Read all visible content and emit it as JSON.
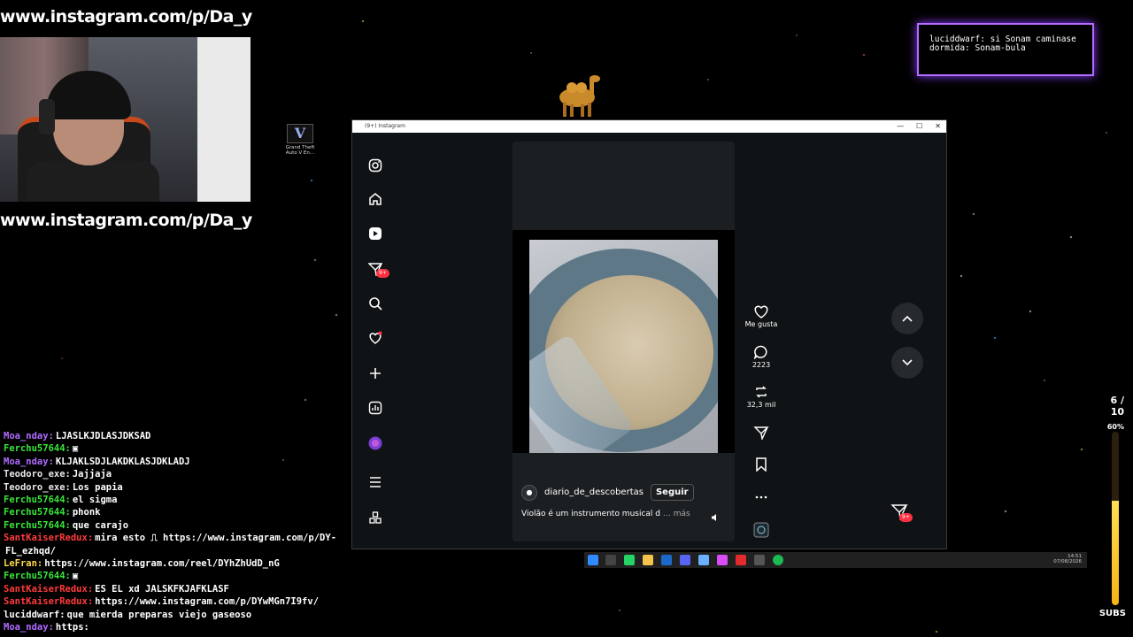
{
  "stream": {
    "url_banner": "www.instagram.com/p/Da_yt",
    "overlay_chat": "luciddwarf: si Sonam caminase dormida: Sonam-bula",
    "sub_goal": {
      "count": "6 / 10",
      "percent": "60%",
      "fraction": 0.6,
      "label": "SUBS"
    }
  },
  "desktop": {
    "icon_label": "Grand Theft Auto V En..."
  },
  "window": {
    "title": "(9+) Instagram",
    "controls": [
      "—",
      "☐",
      "✕"
    ]
  },
  "sidebar": {
    "items": [
      {
        "name": "instagram-logo-icon"
      },
      {
        "name": "home-icon"
      },
      {
        "name": "reels-icon"
      },
      {
        "name": "messages-icon",
        "badge": "9+"
      },
      {
        "name": "search-icon"
      },
      {
        "name": "notifications-icon"
      },
      {
        "name": "create-icon"
      },
      {
        "name": "dashboard-icon"
      },
      {
        "name": "profile-avatar"
      },
      {
        "name": "menu-icon"
      },
      {
        "name": "apps-icon"
      }
    ]
  },
  "reel": {
    "author": "diario_de_descobertas",
    "follow_label": "Seguir",
    "caption": "Violão é um instrumento musical d",
    "caption_more": "… más",
    "actions": {
      "like_label": "Me gusta",
      "comments": "2223",
      "reposts": "32,3 mil"
    }
  },
  "messages_badge": "9+",
  "taskbar": {
    "time": "14:51",
    "date": "07/08/2026"
  },
  "chat": [
    {
      "user": "Moa_nday:",
      "msg": "LJASLKJDLASJDKSAD",
      "color": "#b06cff"
    },
    {
      "user": "Ferchu57644:",
      "msg": "▣",
      "color": "#39e639"
    },
    {
      "user": "Moa_nday:",
      "msg": "KLJAKLSDJLAKDKLASJDKLADJ",
      "color": "#b06cff"
    },
    {
      "user": "Teodoro_exe:",
      "msg": "Jajjaja",
      "color": "#e8e8e8"
    },
    {
      "user": "Teodoro_exe:",
      "msg": "Los papia",
      "color": "#e8e8e8"
    },
    {
      "user": "Ferchu57644:",
      "msg": "el sigma",
      "color": "#39e639"
    },
    {
      "user": "Ferchu57644:",
      "msg": "phonk",
      "color": "#39e639"
    },
    {
      "user": "Ferchu57644:",
      "msg": "que carajo",
      "color": "#39e639"
    },
    {
      "user": "SantKaiserRedux:",
      "msg": "mira esto ⎍ https://www.instagram.com/p/DY-",
      "color": "#ff3b3b"
    },
    {
      "user": "",
      "msg": "FL_ezhqd/",
      "color": "#ffffff"
    },
    {
      "user": "LeFran:",
      "msg": "https://www.instagram.com/reel/DYhZhUdD_nG",
      "color": "#ffd84a"
    },
    {
      "user": "Ferchu57644:",
      "msg": "▣",
      "color": "#39e639"
    },
    {
      "user": "SantKaiserRedux:",
      "msg": "ES EL xd JALSKFKJAFKLASF",
      "color": "#ff3b3b"
    },
    {
      "user": "SantKaiserRedux:",
      "msg": "https://www.instagram.com/p/DYwMGn7I9fv/",
      "color": "#ff3b3b"
    },
    {
      "user": "luciddwarf:",
      "msg": "que mierda preparas viejo gaseoso",
      "color": "#ffffff"
    },
    {
      "user": "Moa_nday:",
      "msg": "https:",
      "color": "#b06cff"
    }
  ]
}
